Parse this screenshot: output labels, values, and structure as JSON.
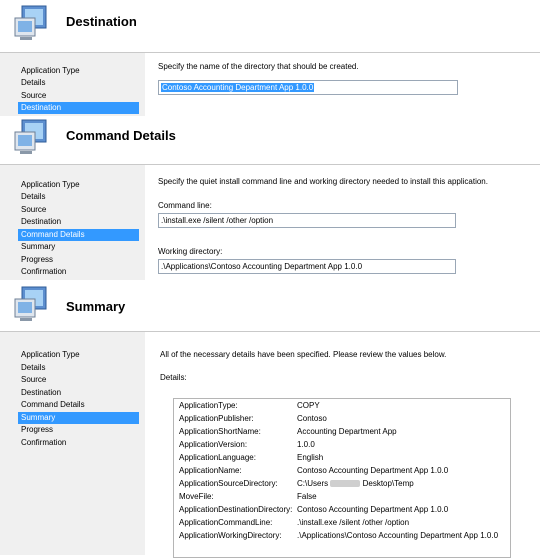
{
  "destination": {
    "title": "Destination",
    "nav": [
      "Application Type",
      "Details",
      "Source",
      "Destination"
    ],
    "instruction": "Specify the name of the directory that should be created.",
    "directory_value": "Contoso Accounting Department App 1.0.0"
  },
  "command": {
    "title": "Command Details",
    "nav": [
      "Application Type",
      "Details",
      "Source",
      "Destination",
      "Command Details",
      "Summary",
      "Progress",
      "Confirmation"
    ],
    "instruction": "Specify the quiet install command line and working directory needed to install this application.",
    "command_line_label": "Command line:",
    "command_line_value": ".\\install.exe /silent /other /option",
    "working_dir_label": "Working directory:",
    "working_dir_value": ".\\Applications\\Contoso Accounting Department App 1.0.0"
  },
  "summary": {
    "title": "Summary",
    "nav": [
      "Application Type",
      "Details",
      "Source",
      "Destination",
      "Command Details",
      "Summary",
      "Progress",
      "Confirmation"
    ],
    "instruction": "All of the necessary details have been specified.  Please review the values below.",
    "details_label": "Details:",
    "details": [
      {
        "key": "ApplicationType:",
        "value": "COPY"
      },
      {
        "key": "ApplicationPublisher:",
        "value": "Contoso"
      },
      {
        "key": "ApplicationShortName:",
        "value": "Accounting Department App"
      },
      {
        "key": "ApplicationVersion:",
        "value": "1.0.0"
      },
      {
        "key": "ApplicationLanguage:",
        "value": "English"
      },
      {
        "key": "ApplicationName:",
        "value": "Contoso Accounting Department App 1.0.0"
      },
      {
        "key": "ApplicationSourceDirectory:",
        "value_prefix": "C:\\Users",
        "value_suffix": "Desktop\\Temp"
      },
      {
        "key": "MoveFile:",
        "value": "False"
      },
      {
        "key": "ApplicationDestinationDirectory:",
        "value": "Contoso Accounting Department App 1.0.0"
      },
      {
        "key": "ApplicationCommandLine:",
        "value": ".\\install.exe /silent /other /option"
      },
      {
        "key": "ApplicationWorkingDirectory:",
        "value": ".\\Applications\\Contoso Accounting Department App 1.0.0"
      }
    ]
  },
  "icon": "computer-monitor-icon"
}
